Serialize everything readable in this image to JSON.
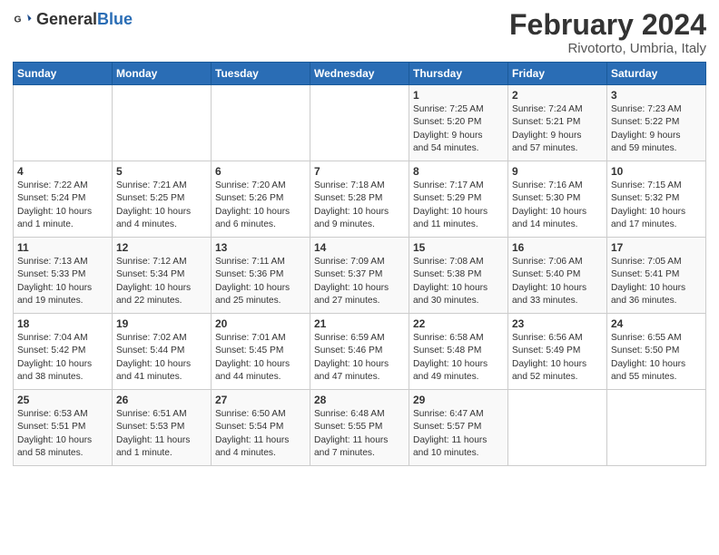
{
  "header": {
    "logo_general": "General",
    "logo_blue": "Blue",
    "title": "February 2024",
    "subtitle": "Rivotorto, Umbria, Italy"
  },
  "days_of_week": [
    "Sunday",
    "Monday",
    "Tuesday",
    "Wednesday",
    "Thursday",
    "Friday",
    "Saturday"
  ],
  "weeks": [
    [
      {
        "day": "",
        "info": ""
      },
      {
        "day": "",
        "info": ""
      },
      {
        "day": "",
        "info": ""
      },
      {
        "day": "",
        "info": ""
      },
      {
        "day": "1",
        "info": "Sunrise: 7:25 AM\nSunset: 5:20 PM\nDaylight: 9 hours\nand 54 minutes."
      },
      {
        "day": "2",
        "info": "Sunrise: 7:24 AM\nSunset: 5:21 PM\nDaylight: 9 hours\nand 57 minutes."
      },
      {
        "day": "3",
        "info": "Sunrise: 7:23 AM\nSunset: 5:22 PM\nDaylight: 9 hours\nand 59 minutes."
      }
    ],
    [
      {
        "day": "4",
        "info": "Sunrise: 7:22 AM\nSunset: 5:24 PM\nDaylight: 10 hours\nand 1 minute."
      },
      {
        "day": "5",
        "info": "Sunrise: 7:21 AM\nSunset: 5:25 PM\nDaylight: 10 hours\nand 4 minutes."
      },
      {
        "day": "6",
        "info": "Sunrise: 7:20 AM\nSunset: 5:26 PM\nDaylight: 10 hours\nand 6 minutes."
      },
      {
        "day": "7",
        "info": "Sunrise: 7:18 AM\nSunset: 5:28 PM\nDaylight: 10 hours\nand 9 minutes."
      },
      {
        "day": "8",
        "info": "Sunrise: 7:17 AM\nSunset: 5:29 PM\nDaylight: 10 hours\nand 11 minutes."
      },
      {
        "day": "9",
        "info": "Sunrise: 7:16 AM\nSunset: 5:30 PM\nDaylight: 10 hours\nand 14 minutes."
      },
      {
        "day": "10",
        "info": "Sunrise: 7:15 AM\nSunset: 5:32 PM\nDaylight: 10 hours\nand 17 minutes."
      }
    ],
    [
      {
        "day": "11",
        "info": "Sunrise: 7:13 AM\nSunset: 5:33 PM\nDaylight: 10 hours\nand 19 minutes."
      },
      {
        "day": "12",
        "info": "Sunrise: 7:12 AM\nSunset: 5:34 PM\nDaylight: 10 hours\nand 22 minutes."
      },
      {
        "day": "13",
        "info": "Sunrise: 7:11 AM\nSunset: 5:36 PM\nDaylight: 10 hours\nand 25 minutes."
      },
      {
        "day": "14",
        "info": "Sunrise: 7:09 AM\nSunset: 5:37 PM\nDaylight: 10 hours\nand 27 minutes."
      },
      {
        "day": "15",
        "info": "Sunrise: 7:08 AM\nSunset: 5:38 PM\nDaylight: 10 hours\nand 30 minutes."
      },
      {
        "day": "16",
        "info": "Sunrise: 7:06 AM\nSunset: 5:40 PM\nDaylight: 10 hours\nand 33 minutes."
      },
      {
        "day": "17",
        "info": "Sunrise: 7:05 AM\nSunset: 5:41 PM\nDaylight: 10 hours\nand 36 minutes."
      }
    ],
    [
      {
        "day": "18",
        "info": "Sunrise: 7:04 AM\nSunset: 5:42 PM\nDaylight: 10 hours\nand 38 minutes."
      },
      {
        "day": "19",
        "info": "Sunrise: 7:02 AM\nSunset: 5:44 PM\nDaylight: 10 hours\nand 41 minutes."
      },
      {
        "day": "20",
        "info": "Sunrise: 7:01 AM\nSunset: 5:45 PM\nDaylight: 10 hours\nand 44 minutes."
      },
      {
        "day": "21",
        "info": "Sunrise: 6:59 AM\nSunset: 5:46 PM\nDaylight: 10 hours\nand 47 minutes."
      },
      {
        "day": "22",
        "info": "Sunrise: 6:58 AM\nSunset: 5:48 PM\nDaylight: 10 hours\nand 49 minutes."
      },
      {
        "day": "23",
        "info": "Sunrise: 6:56 AM\nSunset: 5:49 PM\nDaylight: 10 hours\nand 52 minutes."
      },
      {
        "day": "24",
        "info": "Sunrise: 6:55 AM\nSunset: 5:50 PM\nDaylight: 10 hours\nand 55 minutes."
      }
    ],
    [
      {
        "day": "25",
        "info": "Sunrise: 6:53 AM\nSunset: 5:51 PM\nDaylight: 10 hours\nand 58 minutes."
      },
      {
        "day": "26",
        "info": "Sunrise: 6:51 AM\nSunset: 5:53 PM\nDaylight: 11 hours\nand 1 minute."
      },
      {
        "day": "27",
        "info": "Sunrise: 6:50 AM\nSunset: 5:54 PM\nDaylight: 11 hours\nand 4 minutes."
      },
      {
        "day": "28",
        "info": "Sunrise: 6:48 AM\nSunset: 5:55 PM\nDaylight: 11 hours\nand 7 minutes."
      },
      {
        "day": "29",
        "info": "Sunrise: 6:47 AM\nSunset: 5:57 PM\nDaylight: 11 hours\nand 10 minutes."
      },
      {
        "day": "",
        "info": ""
      },
      {
        "day": "",
        "info": ""
      }
    ]
  ]
}
